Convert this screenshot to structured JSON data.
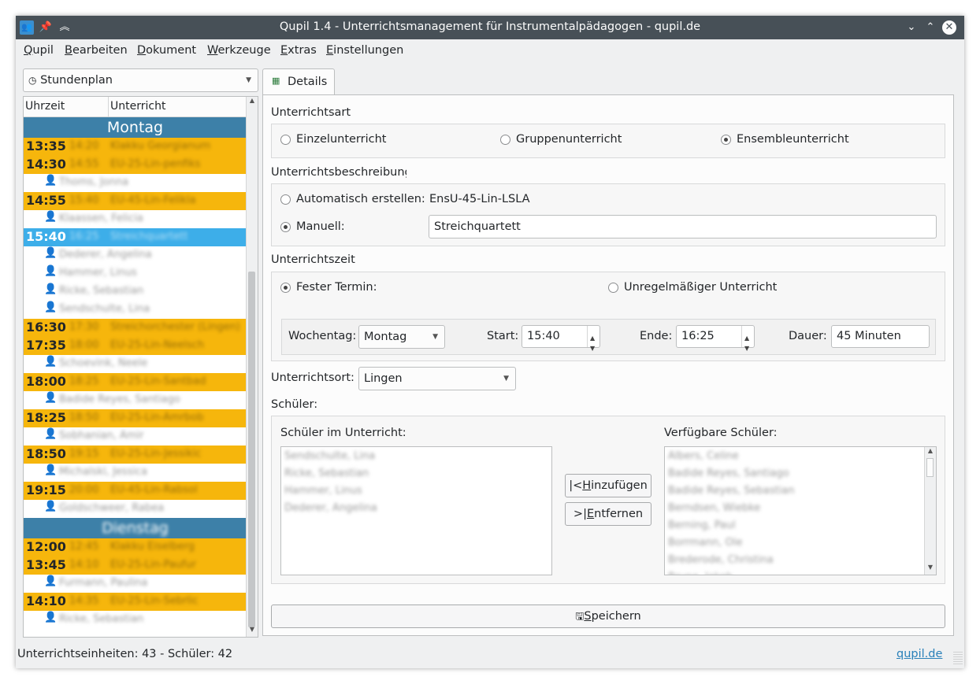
{
  "window": {
    "title": "Qupil 1.4 - Unterrichtsmanagement für Instrumentalpädagogen - qupil.de"
  },
  "menu": [
    {
      "key": "Q",
      "rest": "upil"
    },
    {
      "key": "B",
      "rest": "earbeiten"
    },
    {
      "key": "D",
      "rest": "okument"
    },
    {
      "key": "W",
      "rest": "erkzeuge"
    },
    {
      "key": "E",
      "rest": "xtras"
    },
    {
      "key": "E",
      "rest": "instellungen"
    }
  ],
  "view_selector": {
    "icon": "clock-icon",
    "value": "Stundenplan"
  },
  "schedule": {
    "headers": {
      "time": "Uhrzeit",
      "lesson": "Unterricht"
    },
    "rows": [
      {
        "type": "day",
        "label": "Montag"
      },
      {
        "type": "lesson",
        "start": "13:35",
        "end": "14:20",
        "name": "Klakku Georgianum"
      },
      {
        "type": "lesson",
        "start": "14:30",
        "end": "14:55",
        "name": "EU-25-Lin-penfiks"
      },
      {
        "type": "student",
        "name": "Thoms, Jonna"
      },
      {
        "type": "lesson",
        "start": "14:55",
        "end": "15:40",
        "name": "EU-45-Lin-Felikla"
      },
      {
        "type": "student",
        "name": "Klaassen, Felicia"
      },
      {
        "type": "lesson",
        "start": "15:40",
        "end": "16:25",
        "name": "Streichquartett",
        "selected": true
      },
      {
        "type": "student",
        "name": "Dederer, Angelina"
      },
      {
        "type": "student",
        "name": "Hammer, Linus"
      },
      {
        "type": "student",
        "name": "Ricke, Sebastian"
      },
      {
        "type": "student",
        "name": "Sendschulte, Lina"
      },
      {
        "type": "lesson",
        "start": "16:30",
        "end": "17:30",
        "name": "Streichorchester (Lingen)"
      },
      {
        "type": "lesson",
        "start": "17:35",
        "end": "18:00",
        "name": "EU-25-Lin-Neelsch"
      },
      {
        "type": "student",
        "name": "Schoevink, Neele"
      },
      {
        "type": "lesson",
        "start": "18:00",
        "end": "18:25",
        "name": "EU-25-Lin-Santbad"
      },
      {
        "type": "student",
        "name": "Badide Reyes, Santiago"
      },
      {
        "type": "lesson",
        "start": "18:25",
        "end": "18:50",
        "name": "EU-25-Lin-Amrbob"
      },
      {
        "type": "student",
        "name": "Sobhanian, Amir"
      },
      {
        "type": "lesson",
        "start": "18:50",
        "end": "19:15",
        "name": "EU-25-Lin-Jessikic"
      },
      {
        "type": "student",
        "name": "Michalski, Jessica"
      },
      {
        "type": "lesson",
        "start": "19:15",
        "end": "20:00",
        "name": "EU-45-Lin-Rabsol"
      },
      {
        "type": "student",
        "name": "Goldschweer, Rabea"
      },
      {
        "type": "day",
        "label": "Dienstag",
        "blurred": true
      },
      {
        "type": "lesson",
        "start": "12:00",
        "end": "12:45",
        "name": "Klakku Eiselberg"
      },
      {
        "type": "lesson",
        "start": "13:45",
        "end": "14:10",
        "name": "EU-25-Lin-Paufur"
      },
      {
        "type": "student",
        "name": "Furmann, Paulina"
      },
      {
        "type": "lesson",
        "start": "14:10",
        "end": "14:35",
        "name": "EU-25-Lin-Sebrlic"
      },
      {
        "type": "student",
        "name": "Ricke, Sebastian"
      }
    ]
  },
  "tab": {
    "label": "Details",
    "icon": "calendar-icon"
  },
  "lesson_type": {
    "heading": "Unterrichtsart",
    "options": [
      "Einzelunterricht",
      "Gruppenunterricht",
      "Ensembleunterricht"
    ],
    "selected": 2
  },
  "description": {
    "heading": "Unterrichtsbeschreibung",
    "auto_label": "Automatisch erstellen:",
    "auto_value": "EnsU-45-Lin-LSLA",
    "manual_label": "Manuell:",
    "manual_value": "Streichquartett",
    "selected": "manual"
  },
  "time": {
    "heading": "Unterrichtszeit",
    "fixed_label": "Fester Termin:",
    "irregular_label": "Unregelmäßiger Unterricht",
    "selected": "fixed",
    "weekday_label": "Wochentag:",
    "weekday_value": "Montag",
    "start_label": "Start:",
    "start_value": "15:40",
    "end_label": "Ende:",
    "end_value": "16:25",
    "duration_label": "Dauer:",
    "duration_value": "45 Minuten"
  },
  "location": {
    "label": "Unterrichtsort:",
    "value": "Lingen"
  },
  "students": {
    "heading": "Schüler:",
    "in_lesson_label": "Schüler im Unterricht:",
    "in_lesson": [
      "Sendschulte, Lina",
      "Ricke, Sebastian",
      "Hammer, Linus",
      "Dederer, Angelina"
    ],
    "available_label": "Verfügbare Schüler:",
    "available": [
      "Albers, Celine",
      "Badide Reyes, Santiago",
      "Badide Reyes, Sebastian",
      "Berndsen, Wiebke",
      "Berning, Paul",
      "Borrmann, Ole",
      "Brederode, Christina",
      "Brune, Jakob"
    ],
    "add_key": "H",
    "add_rest": "inzufügen",
    "remove_key": "E",
    "remove_rest": "ntfernen"
  },
  "save": {
    "key": "S",
    "rest": "peichern"
  },
  "status": {
    "text": "Unterrichtseinheiten: 43 - Schüler: 42",
    "link": "qupil.de"
  }
}
